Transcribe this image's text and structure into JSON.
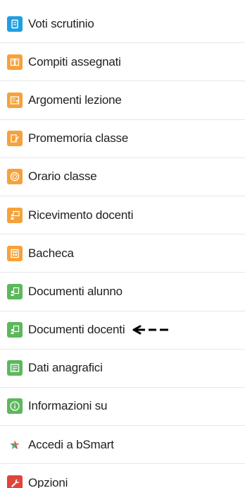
{
  "menu": {
    "items": [
      {
        "label": "Voti scrutinio",
        "icon": "grades-doc-icon",
        "color": "#1E9FE0"
      },
      {
        "label": "Compiti assegnati",
        "icon": "homework-book-icon",
        "color": "#F6A23B"
      },
      {
        "label": "Argomenti lezione",
        "icon": "lesson-topics-icon",
        "color": "#F6A23B"
      },
      {
        "label": "Promemoria classe",
        "icon": "note-pencil-icon",
        "color": "#F6A23B"
      },
      {
        "label": "Orario classe",
        "icon": "clock-icon",
        "color": "#F6A23B"
      },
      {
        "label": "Ricevimento docenti",
        "icon": "teacher-board-icon",
        "color": "#F6A23B"
      },
      {
        "label": "Bacheca",
        "icon": "bulletin-board-icon",
        "color": "#F6A23B"
      },
      {
        "label": "Documenti alunno",
        "icon": "student-document-icon",
        "color": "#5CB85C"
      },
      {
        "label": "Documenti docenti",
        "icon": "teacher-document-icon",
        "color": "#5CB85C"
      },
      {
        "label": "Dati anagrafici",
        "icon": "profile-card-icon",
        "color": "#5CB85C"
      },
      {
        "label": "Informazioni su",
        "icon": "info-icon",
        "color": "#5CB85C"
      },
      {
        "label": "Accedi a bSmart",
        "icon": "bsmart-star-icon",
        "color": "#E86A2C"
      },
      {
        "label": "Opzioni",
        "icon": "wrench-icon",
        "color": "#E0443A"
      }
    ]
  }
}
